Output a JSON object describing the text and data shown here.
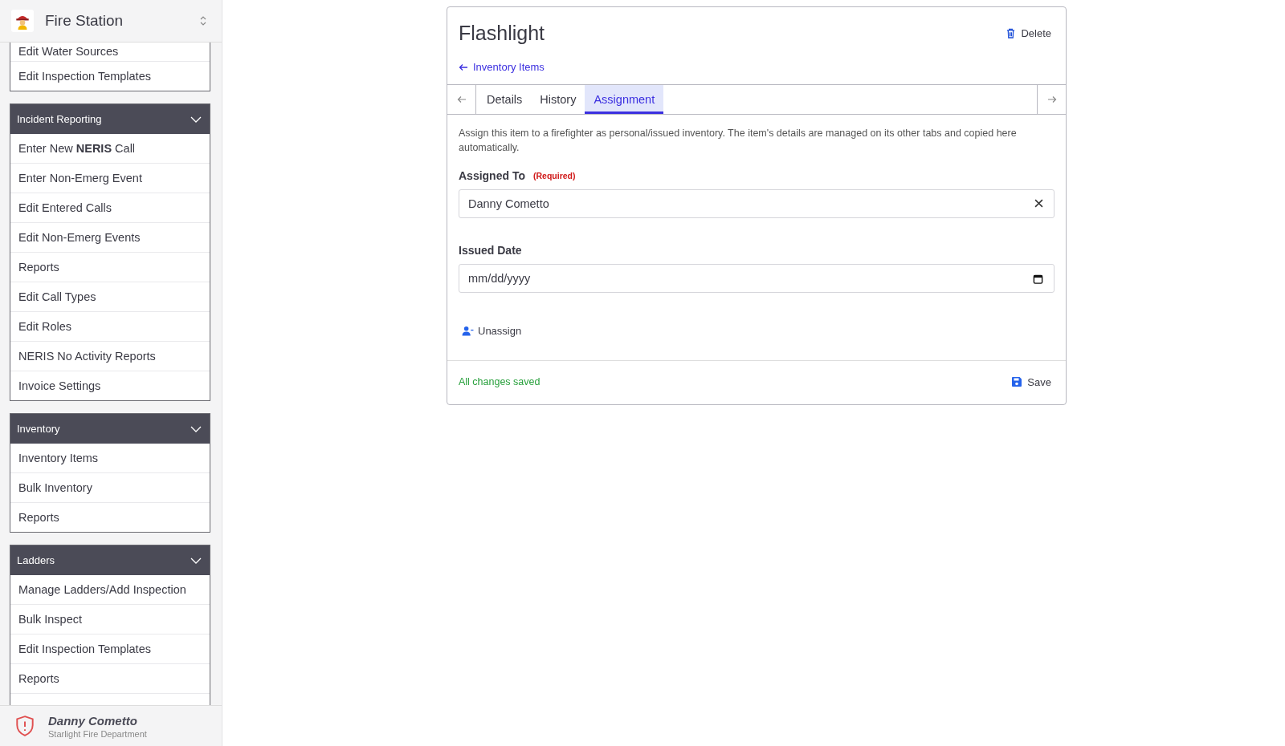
{
  "sidebar": {
    "app_title": "Fire Station",
    "groups": [
      {
        "items": [
          "Edit Water Sources",
          "Edit Inspection Templates"
        ]
      },
      {
        "title": "Incident Reporting",
        "expanded": true,
        "items": [
          "Enter New **NERIS** Call",
          "Enter Non-Emerg Event",
          "Edit Entered Calls",
          "Edit Non-Emerg Events",
          "Reports",
          "Edit Call Types",
          "Edit Roles",
          "NERIS No Activity Reports",
          "Invoice Settings"
        ]
      },
      {
        "title": "Inventory",
        "expanded": true,
        "items": [
          "Inventory Items",
          "Bulk Inventory",
          "Reports"
        ]
      },
      {
        "title": "Ladders",
        "expanded": true,
        "items": [
          "Manage Ladders/Add Inspection",
          "Bulk Inspect",
          "Edit Inspection Templates",
          "Reports"
        ]
      }
    ],
    "user": {
      "name": "Danny Cometto",
      "department": "Starlight Fire Department"
    }
  },
  "item": {
    "title": "Flashlight",
    "delete_label": "Delete",
    "back_link": "Inventory Items",
    "tabs": [
      {
        "label": "Details",
        "selected": false
      },
      {
        "label": "History",
        "selected": false
      },
      {
        "label": "Assignment",
        "selected": true
      }
    ],
    "description": "Assign this item to a firefighter as personal/issued inventory. The item's details are managed on its other tabs and copied here automatically.",
    "assigned_to": {
      "label": "Assigned To",
      "required_note": "(Required)",
      "value": "Danny Cometto"
    },
    "issued_date": {
      "label": "Issued Date",
      "placeholder": "mm/dd/yyyy"
    },
    "unassign_label": "Unassign",
    "status": "All changes saved",
    "save_label": "Save"
  }
}
